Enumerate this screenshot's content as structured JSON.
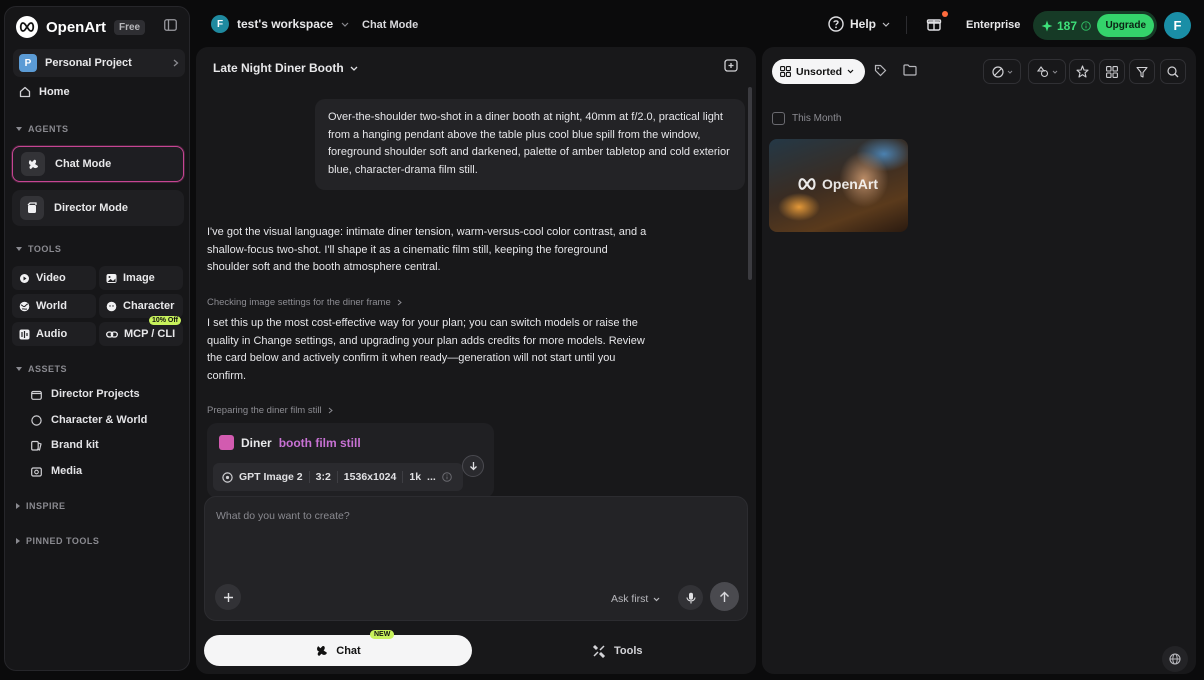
{
  "brand": {
    "name": "OpenArt",
    "plan_badge": "Free"
  },
  "sidebar": {
    "project": {
      "avatar": "P",
      "label": "Personal Project"
    },
    "home_label": "Home",
    "agents_heading": "AGENTS",
    "agents": [
      {
        "label": "Chat Mode",
        "active": true
      },
      {
        "label": "Director Mode",
        "active": false
      }
    ],
    "tools_heading": "TOOLS",
    "tools": [
      {
        "label": "Video"
      },
      {
        "label": "Image"
      },
      {
        "label": "World"
      },
      {
        "label": "Character"
      },
      {
        "label": "Audio"
      },
      {
        "label": "MCP / CLI",
        "badge": "10% Off"
      }
    ],
    "assets_heading": "ASSETS",
    "assets": [
      {
        "label": "Director Projects"
      },
      {
        "label": "Character & World"
      },
      {
        "label": "Brand kit"
      },
      {
        "label": "Media"
      }
    ],
    "inspire_heading": "INSPIRE",
    "pinned_heading": "PINNED TOOLS"
  },
  "header": {
    "workspace_avatar": "F",
    "workspace": "test's workspace",
    "breadcrumb": "Chat Mode",
    "help": "Help",
    "enterprise": "Enterprise",
    "credits": "187",
    "upgrade": "Upgrade",
    "user_avatar": "F"
  },
  "chat": {
    "title": "Late Night Diner Booth",
    "user_message": "Over-the-shoulder two-shot in a diner booth at night, 40mm at f/2.0, practical light from a hanging pendant above the table plus cool blue spill from the window, foreground shoulder soft and darkened, palette of amber tabletop and cold exterior blue, character-drama film still.",
    "ai_message_1": "I've got the visual language: intimate diner tension, warm-versus-cool color contrast, and a shallow-focus two-shot. I'll shape it as a cinematic film still, keeping the foreground shoulder soft and the booth atmosphere central.",
    "step_1": "Checking image settings for the diner frame",
    "ai_message_2": "I set this up the most cost-effective way for your plan; you can switch models or raise the quality in Change settings, and upgrading your plan adds credits for more models. Review the card below and actively confirm it when ready—generation will not start until you confirm.",
    "step_2": "Preparing the diner film still",
    "card": {
      "title_part1": "Diner",
      "title_part2": "booth film still",
      "model": "GPT Image 2",
      "ratio": "3:2",
      "size": "1536x1024",
      "count": "1k",
      "more": "..."
    },
    "composer": {
      "placeholder": "What do you want to create?",
      "mode": "Ask first"
    },
    "tabs": {
      "chat": "Chat",
      "chat_badge": "NEW",
      "tools": "Tools"
    }
  },
  "gallery": {
    "sort_label": "Unsorted",
    "group_label": "This Month",
    "thumbnail_watermark": "OpenArt"
  },
  "colors": {
    "accent_pink": "#c64592",
    "credit_green": "#34d36b",
    "background": "#0b0b0c",
    "panel": "#18181a"
  }
}
